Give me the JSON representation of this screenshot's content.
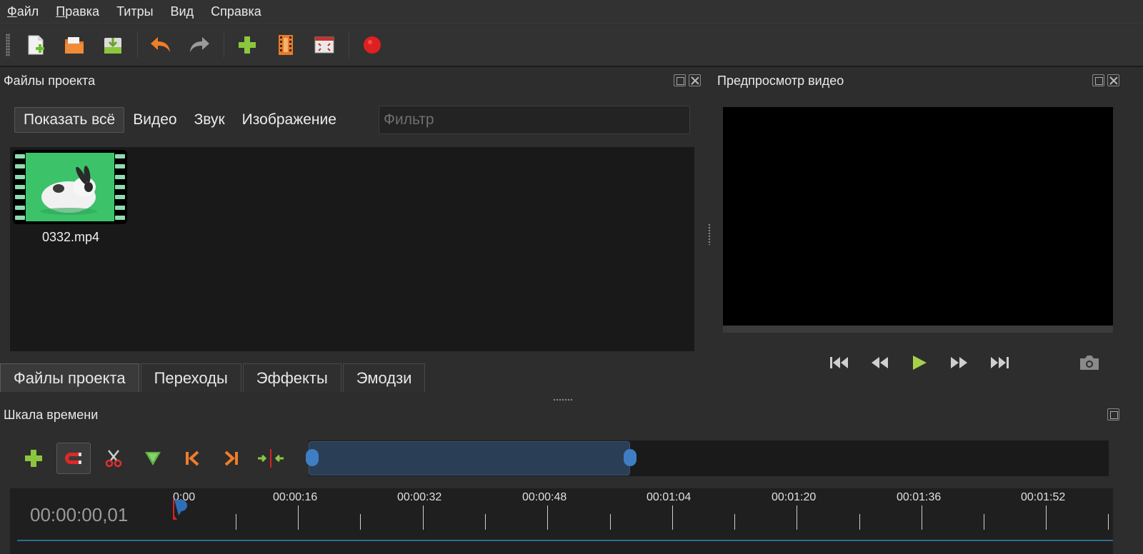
{
  "menu": {
    "items": [
      {
        "label": "Файл",
        "underline": "Ф",
        "rest": "айл"
      },
      {
        "label": "Правка",
        "underline": "П",
        "rest": "равка"
      },
      {
        "label": "Титры",
        "underline": "",
        "rest": "Титры"
      },
      {
        "label": "Вид",
        "underline": "",
        "rest": "Вид"
      },
      {
        "label": "Справка",
        "underline": "",
        "rest": "Справка"
      }
    ]
  },
  "toolbar": {
    "icons": [
      "new-project-icon",
      "open-project-icon",
      "save-project-icon",
      "undo-icon",
      "redo-icon",
      "import-files-icon",
      "profile-icon",
      "fullscreen-icon",
      "export-video-icon"
    ]
  },
  "project_files": {
    "title": "Файлы проекта",
    "filters": [
      "Показать всё",
      "Видео",
      "Звук",
      "Изображение"
    ],
    "filter_placeholder": "Фильтр",
    "files": [
      {
        "name": "0332.mp4"
      }
    ]
  },
  "tabs": [
    "Файлы проекта",
    "Переходы",
    "Эффекты",
    "Эмодзи"
  ],
  "preview": {
    "title": "Предпросмотр видео",
    "controls": [
      "jump-start-icon",
      "rewind-icon",
      "play-icon",
      "fast-forward-icon",
      "jump-end-icon",
      "camera-icon"
    ]
  },
  "timeline": {
    "title": "Шкала времени",
    "current_time": "00:00:00,01",
    "tick_labels": [
      "0:00",
      "00:00:16",
      "00:00:32",
      "00:00:48",
      "00:01:04",
      "00:01:20",
      "00:01:36",
      "00:01:52"
    ],
    "tools": [
      "add-track-icon",
      "snap-magnet-icon",
      "razor-icon",
      "add-marker-icon",
      "previous-marker-icon",
      "next-marker-icon",
      "center-playhead-icon"
    ]
  },
  "colors": {
    "accent_green": "#8cc63f",
    "accent_orange": "#f07d28",
    "record_red": "#e02020",
    "selection_blue": "#3f7ec4"
  }
}
